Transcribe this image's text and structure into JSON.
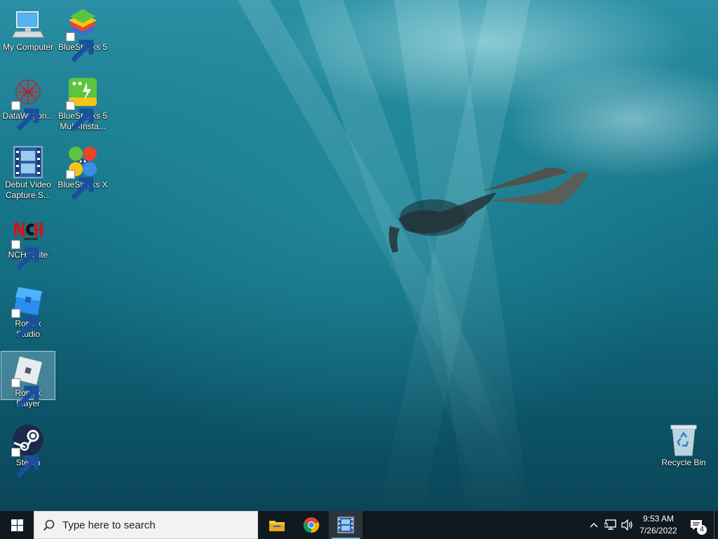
{
  "desktop": {
    "icons": [
      {
        "label": "My Computer",
        "icon": "computer-icon"
      },
      {
        "label": "BlueStacks 5",
        "icon": "bluestacks-icon"
      },
      {
        "label": "DataWagon...",
        "icon": "datawagon-icon"
      },
      {
        "label": "BlueStacks 5\nMulti-Insta...",
        "icon": "bluestacks-multi-instance-icon"
      },
      {
        "label": "Debut Video\nCapture S...",
        "icon": "debut-video-icon"
      },
      {
        "label": "BlueStacks X",
        "icon": "bluestacks-x-icon"
      },
      {
        "label": "NCH Suite",
        "icon": "nch-suite-icon"
      },
      {
        "label": "Roblox Studio",
        "icon": "roblox-studio-icon"
      },
      {
        "label": "Roblox Player",
        "icon": "roblox-player-icon",
        "selected": true
      },
      {
        "label": "Steam",
        "icon": "steam-icon"
      },
      {
        "label": "Recycle Bin",
        "icon": "recycle-bin-icon"
      }
    ]
  },
  "taskbar": {
    "search_placeholder": "Type here to search",
    "pinned": [
      "file-explorer-icon",
      "chrome-icon",
      "debut-video-icon"
    ],
    "active_app": "debut-video-icon",
    "tray_icons": [
      "chevron-up-icon",
      "network-icon",
      "volume-icon"
    ],
    "time": "9:53 AM",
    "date": "7/26/2022",
    "notification_count": "4"
  },
  "colors": {
    "taskbar": "#101820",
    "search_bg": "#f2f2f2",
    "accent": "#76b9ed"
  }
}
